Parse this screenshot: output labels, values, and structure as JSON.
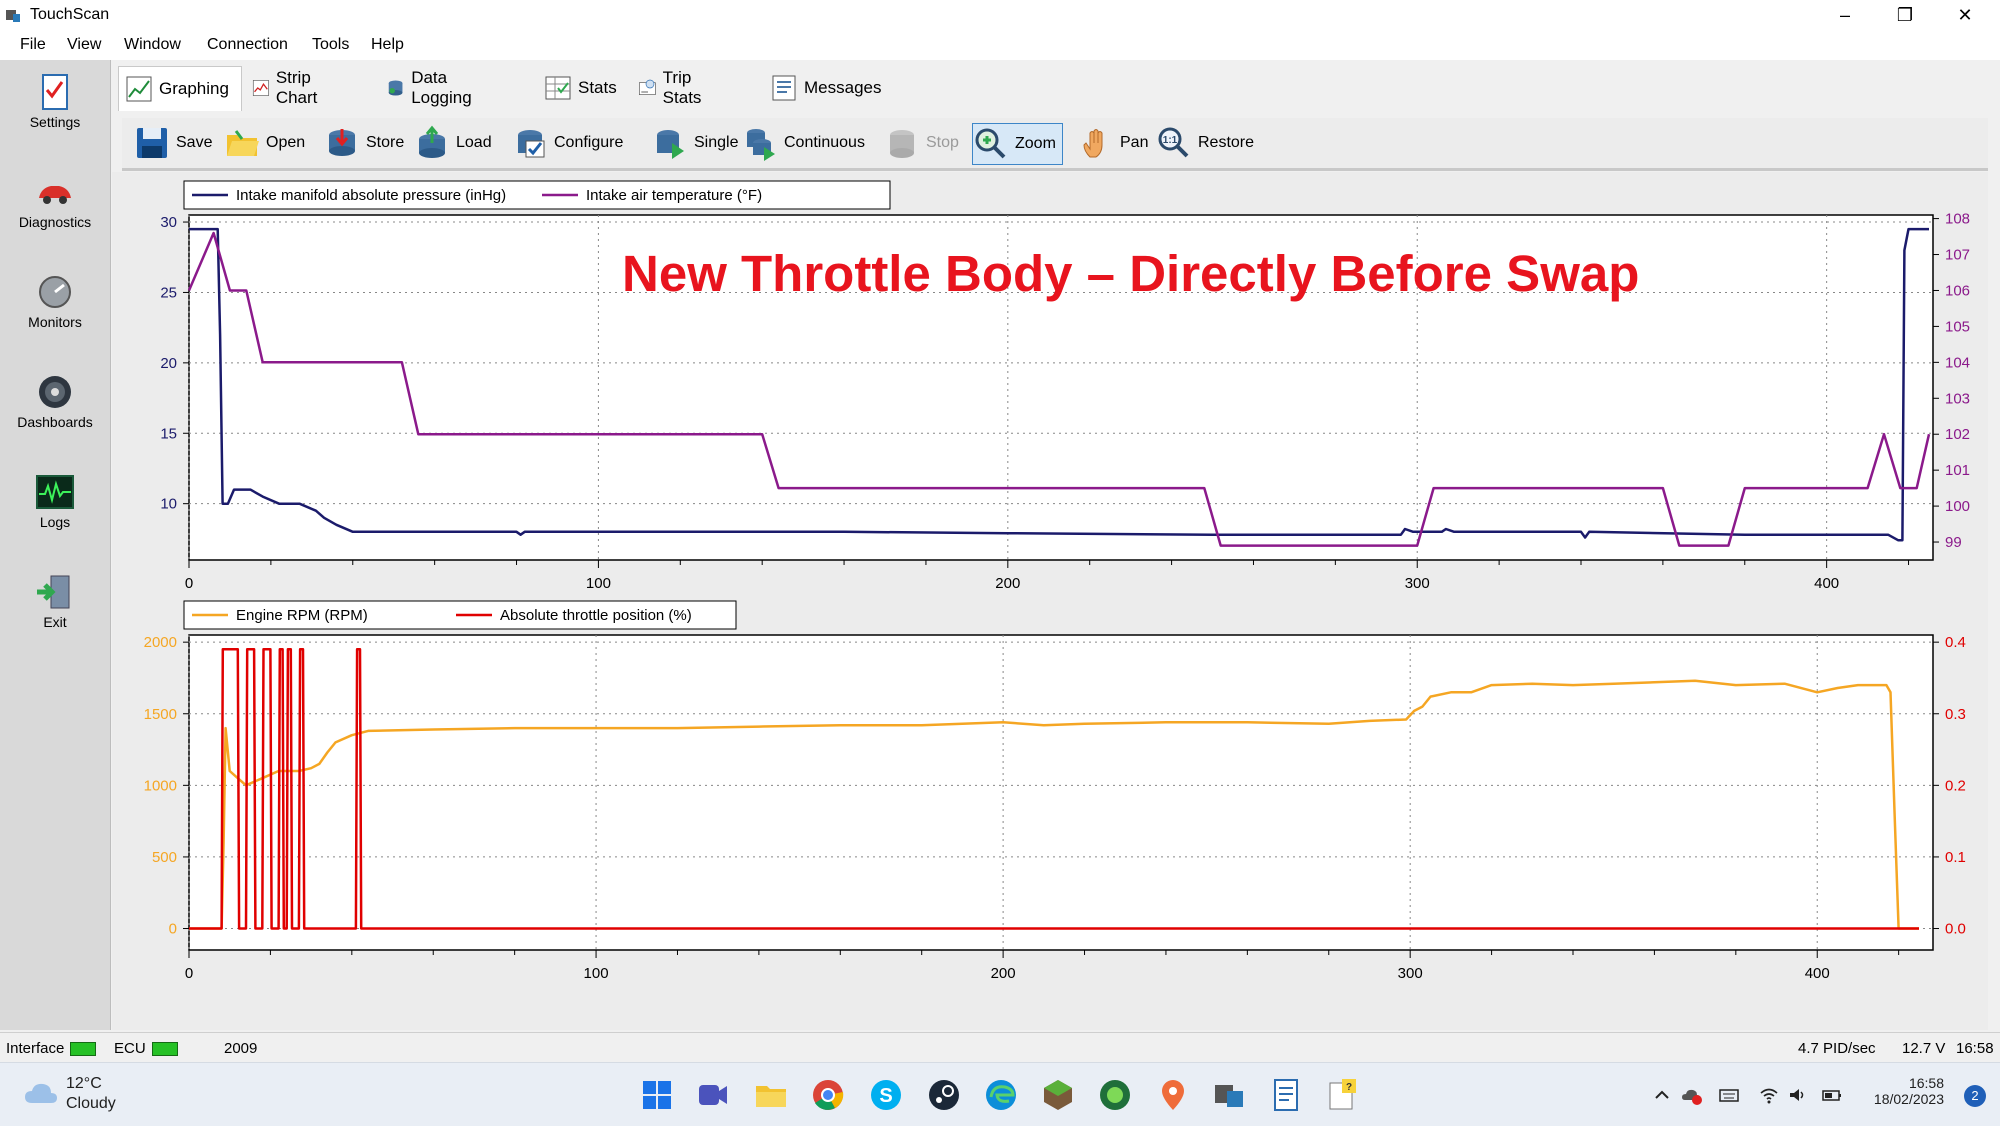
{
  "window": {
    "title": "TouchScan",
    "controls": {
      "minimize": "–",
      "restore": "❐",
      "close": "✕"
    }
  },
  "menu": [
    "File",
    "View",
    "Window",
    "Connection",
    "Tools",
    "Help"
  ],
  "sidebar": [
    {
      "label": "Settings",
      "icon": "checklist-icon"
    },
    {
      "label": "Diagnostics",
      "icon": "car-icon"
    },
    {
      "label": "Monitors",
      "icon": "gauge-icon"
    },
    {
      "label": "Dashboards",
      "icon": "dashboard-dial-icon"
    },
    {
      "label": "Logs",
      "icon": "waveform-icon"
    },
    {
      "label": "Exit",
      "icon": "exit-door-icon"
    }
  ],
  "tabs": [
    {
      "label": "Graphing",
      "icon": "line-graph-icon",
      "active": true
    },
    {
      "label": "Strip Chart",
      "icon": "strip-chart-icon"
    },
    {
      "label": "Data Logging",
      "icon": "database-icon"
    },
    {
      "label": "Stats",
      "icon": "stats-table-icon"
    },
    {
      "label": "Trip Stats",
      "icon": "trip-stats-icon"
    },
    {
      "label": "Messages",
      "icon": "messages-icon"
    }
  ],
  "toolbar": [
    {
      "label": "Save",
      "icon": "floppy-icon"
    },
    {
      "label": "Open",
      "icon": "open-folder-icon"
    },
    {
      "label": "Store",
      "icon": "store-db-icon"
    },
    {
      "label": "Load",
      "icon": "load-db-icon"
    },
    {
      "label": "Configure",
      "icon": "configure-icon"
    },
    {
      "label": "Single",
      "icon": "single-capture-icon"
    },
    {
      "label": "Continuous",
      "icon": "continuous-capture-icon"
    },
    {
      "label": "Stop",
      "icon": "stop-icon",
      "disabled": true
    },
    {
      "label": "Zoom",
      "icon": "zoom-icon",
      "pressed": true
    },
    {
      "label": "Pan",
      "icon": "hand-icon"
    },
    {
      "label": "Restore",
      "icon": "restore-zoom-icon"
    }
  ],
  "overlay_title": "New Throttle Body – Directly Before Swap",
  "colors": {
    "map": "#1b1b6b",
    "iat": "#8b1a8b",
    "rpm": "#f5a623",
    "tps": "#e00000",
    "left_axis_top": "#1b1b6b",
    "right_axis_top": "#8b1a8b",
    "left_axis_bottom": "#f5a623",
    "right_axis_bottom": "#e00000"
  },
  "chart_data": [
    {
      "type": "line",
      "legend": [
        "Intake manifold absolute pressure (inHg)",
        "Intake air temperature (°F)"
      ],
      "xlim": [
        0,
        425
      ],
      "x_ticks": [
        0,
        100,
        200,
        300,
        400
      ],
      "ylim_left": [
        6,
        30.5
      ],
      "y_ticks_left": [
        10,
        15,
        20,
        25,
        30
      ],
      "ylim_right": [
        98.5,
        108.1
      ],
      "y_ticks_right": [
        99,
        100,
        101,
        102,
        103,
        104,
        105,
        106,
        107,
        108
      ],
      "series": [
        {
          "name": "Intake manifold absolute pressure (inHg)",
          "axis": "left",
          "x": [
            0,
            7,
            7.6,
            8.2,
            9.5,
            11,
            15,
            18,
            22,
            27,
            31,
            33,
            36,
            40,
            80,
            81,
            82,
            83,
            100,
            140,
            160,
            200,
            250,
            290,
            296,
            297,
            299,
            300,
            306,
            307,
            309,
            340,
            341,
            342,
            380,
            415,
            417.5,
            418.5,
            419,
            420,
            425
          ],
          "y": [
            29.5,
            29.5,
            22,
            10,
            10,
            11,
            11,
            10.5,
            10,
            10,
            9.5,
            9,
            8.5,
            8,
            8,
            7.8,
            8,
            8,
            8,
            8,
            8,
            7.9,
            7.8,
            7.8,
            7.8,
            8.2,
            8,
            8,
            8,
            8.2,
            8,
            8,
            7.6,
            8,
            7.8,
            7.8,
            7.4,
            7.4,
            28,
            29.5,
            29.5
          ]
        },
        {
          "name": "Intake air temperature (°F)",
          "axis": "right",
          "x": [
            0,
            6,
            10,
            14,
            18,
            52,
            56,
            140,
            144,
            248,
            252,
            300,
            304,
            360,
            364,
            376,
            380,
            410,
            414,
            418,
            422,
            425
          ],
          "y": [
            106,
            107.6,
            106,
            106,
            104,
            104,
            102,
            102,
            100.5,
            100.5,
            98.9,
            98.9,
            100.5,
            100.5,
            98.9,
            98.9,
            100.5,
            100.5,
            102,
            100.5,
            100.5,
            102
          ]
        }
      ]
    },
    {
      "type": "line",
      "legend": [
        "Engine RPM (RPM)",
        "Absolute throttle position (%)"
      ],
      "xlim": [
        0,
        425
      ],
      "x_ticks": [
        0,
        100,
        200,
        300,
        400
      ],
      "ylim_left": [
        -150,
        2050
      ],
      "y_ticks_left": [
        0,
        500,
        1000,
        1500,
        2000
      ],
      "ylim_right": [
        -0.03,
        0.41
      ],
      "y_ticks_right": [
        0.0,
        0.1,
        0.2,
        0.3,
        0.4
      ],
      "y_tick_labels_right": [
        "0.0",
        "0.1",
        "0.2",
        "0.3",
        "0.4"
      ],
      "series": [
        {
          "name": "Engine RPM (RPM)",
          "axis": "left",
          "x": [
            0,
            8,
            8.5,
            9,
            10,
            12,
            14,
            18,
            22,
            27,
            30,
            32,
            34,
            36,
            40,
            44,
            60,
            80,
            100,
            120,
            140,
            160,
            180,
            200,
            210,
            220,
            240,
            260,
            280,
            290,
            299,
            301,
            303,
            305,
            310,
            315,
            320,
            330,
            340,
            350,
            360,
            370,
            380,
            392,
            400,
            405,
            410,
            412,
            417,
            418,
            419,
            420,
            425
          ],
          "y": [
            0,
            0,
            600,
            1400,
            1100,
            1050,
            1000,
            1050,
            1100,
            1100,
            1120,
            1150,
            1230,
            1300,
            1350,
            1380,
            1390,
            1400,
            1400,
            1400,
            1410,
            1420,
            1420,
            1440,
            1420,
            1430,
            1440,
            1440,
            1430,
            1450,
            1460,
            1520,
            1550,
            1620,
            1650,
            1650,
            1700,
            1710,
            1700,
            1710,
            1720,
            1730,
            1700,
            1710,
            1650,
            1680,
            1700,
            1700,
            1700,
            1650,
            800,
            0,
            0
          ]
        },
        {
          "name": "Absolute throttle position (%)",
          "axis": "right",
          "x": [
            0,
            8,
            8.3,
            12,
            12.3,
            14,
            14.3,
            16,
            16.3,
            18,
            18.3,
            20,
            20.3,
            22,
            22.3,
            23,
            23.3,
            24,
            24.3,
            25,
            25.3,
            27,
            27.3,
            28,
            28.3,
            41,
            41.3,
            42,
            42.3,
            425
          ],
          "y": [
            0,
            0,
            0.39,
            0.39,
            0,
            0,
            0.39,
            0.39,
            0,
            0,
            0.39,
            0.39,
            0,
            0,
            0.39,
            0.39,
            0,
            0,
            0.39,
            0.39,
            0,
            0,
            0.39,
            0.39,
            0,
            0,
            0.39,
            0.39,
            0,
            0
          ]
        }
      ]
    }
  ],
  "status": {
    "interface": "Interface",
    "ecu": "ECU",
    "year": "2009",
    "pid_rate": "4.7 PID/sec",
    "voltage": "12.7 V",
    "time": "16:58"
  },
  "taskbar": {
    "weather_temp": "12°C",
    "weather_desc": "Cloudy",
    "clock_time": "16:58",
    "clock_date": "18/02/2023",
    "notifications": "2",
    "apps": [
      "start-icon",
      "meet-icon",
      "file-explorer-icon",
      "chrome-icon",
      "skype-icon",
      "steam-icon",
      "edge-icon",
      "minecraft-icon",
      "edge-dev-icon",
      "maps-icon",
      "touchscan-icon",
      "document-icon",
      "notes-icon"
    ]
  }
}
